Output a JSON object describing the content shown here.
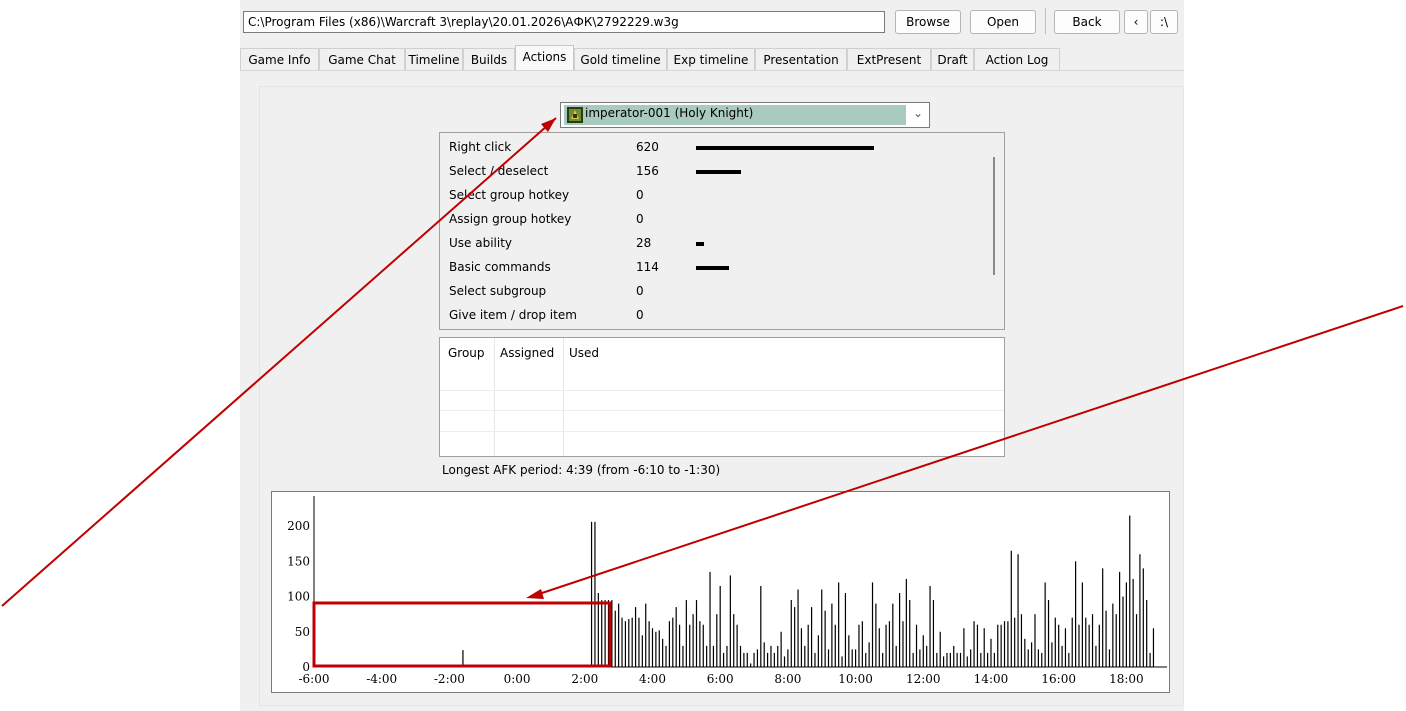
{
  "toolbar": {
    "path": "C:\\Program Files (x86)\\Warcraft 3\\replay\\20.01.2026\\АФК\\2792229.w3g",
    "browse": "Browse",
    "open": "Open",
    "back": "Back",
    "prev": "‹",
    "next": ":\\"
  },
  "tabs": [
    "Game Info",
    "Game Chat",
    "Timeline",
    "Builds",
    "Actions",
    "Gold timeline",
    "Exp timeline",
    "Presentation",
    "ExtPresent",
    "Draft",
    "Action Log"
  ],
  "active_tab": "Actions",
  "player": {
    "selected": "imperator-001 (Holy Knight)"
  },
  "actions": [
    {
      "name": "Right click",
      "value": "620",
      "bar": 620
    },
    {
      "name": "Select / deselect",
      "value": "156",
      "bar": 156
    },
    {
      "name": "Select group hotkey",
      "value": "0",
      "bar": 0
    },
    {
      "name": "Assign group hotkey",
      "value": "0",
      "bar": 0
    },
    {
      "name": "Use ability",
      "value": "28",
      "bar": 28
    },
    {
      "name": "Basic commands",
      "value": "114",
      "bar": 114
    },
    {
      "name": "Select subgroup",
      "value": "0",
      "bar": 0
    },
    {
      "name": "Give item / drop item",
      "value": "0",
      "bar": 0
    }
  ],
  "group_table": {
    "headers": [
      "Group",
      "Assigned",
      "Used"
    ]
  },
  "afk_text": "Longest AFK period: 4:39 (from -6:10 to -1:30)",
  "colors": {
    "accent_red": "#c00000",
    "selection": "#a9cabf"
  },
  "chart_data": {
    "type": "bar",
    "xlabel": "",
    "ylabel": "",
    "xlim": [
      -6,
      19.2
    ],
    "ylim": [
      0,
      220
    ],
    "y_ticks": [
      "0",
      "50",
      "100",
      "150",
      "200"
    ],
    "x_ticks": [
      "-6:00",
      "-4:00",
      "-2:00",
      "0:00",
      "2:00",
      "4:00",
      "6:00",
      "8:00",
      "10:00",
      "12:00",
      "14:00",
      "16:00",
      "18:00"
    ],
    "x": [
      -1.6,
      2.2,
      2.3,
      2.4,
      2.5,
      2.6,
      2.7,
      2.8,
      2.9,
      3.0,
      3.1,
      3.2,
      3.3,
      3.4,
      3.5,
      3.6,
      3.7,
      3.8,
      3.9,
      4.0,
      4.1,
      4.2,
      4.3,
      4.4,
      4.5,
      4.6,
      4.7,
      4.8,
      4.9,
      5.0,
      5.1,
      5.2,
      5.3,
      5.4,
      5.5,
      5.6,
      5.7,
      5.8,
      5.9,
      6.0,
      6.1,
      6.2,
      6.3,
      6.4,
      6.5,
      6.6,
      6.7,
      6.8,
      6.9,
      7.0,
      7.1,
      7.2,
      7.3,
      7.4,
      7.5,
      7.6,
      7.7,
      7.8,
      7.9,
      8.0,
      8.1,
      8.2,
      8.3,
      8.4,
      8.5,
      8.6,
      8.7,
      8.8,
      8.9,
      9.0,
      9.1,
      9.2,
      9.3,
      9.4,
      9.5,
      9.6,
      9.7,
      9.8,
      9.9,
      10.0,
      10.1,
      10.2,
      10.3,
      10.4,
      10.5,
      10.6,
      10.7,
      10.8,
      10.9,
      11.0,
      11.1,
      11.2,
      11.3,
      11.4,
      11.5,
      11.6,
      11.7,
      11.8,
      11.9,
      12.0,
      12.1,
      12.2,
      12.3,
      12.4,
      12.5,
      12.6,
      12.7,
      12.8,
      12.9,
      13.0,
      13.1,
      13.2,
      13.3,
      13.4,
      13.5,
      13.6,
      13.7,
      13.8,
      13.9,
      14.0,
      14.1,
      14.2,
      14.3,
      14.4,
      14.5,
      14.6,
      14.7,
      14.8,
      14.9,
      15.0,
      15.1,
      15.2,
      15.3,
      15.4,
      15.5,
      15.6,
      15.7,
      15.8,
      15.9,
      16.0,
      16.1,
      16.2,
      16.3,
      16.4,
      16.5,
      16.6,
      16.7,
      16.8,
      16.9,
      17.0,
      17.1,
      17.2,
      17.3,
      17.4,
      17.5,
      17.6,
      17.7,
      17.8,
      17.9,
      18.0,
      18.1,
      18.2,
      18.3,
      18.4,
      18.5,
      18.6,
      18.7,
      18.8,
      18.9,
      19.0,
      19.1
    ],
    "values": [
      24,
      206,
      206,
      105,
      95,
      95,
      95,
      95,
      80,
      90,
      70,
      65,
      68,
      70,
      85,
      70,
      45,
      90,
      65,
      55,
      50,
      52,
      40,
      30,
      65,
      70,
      85,
      60,
      30,
      95,
      60,
      75,
      95,
      65,
      60,
      30,
      135,
      30,
      75,
      115,
      20,
      30,
      130,
      75,
      60,
      30,
      20,
      20,
      5,
      20,
      25,
      115,
      35,
      20,
      30,
      20,
      30,
      50,
      15,
      25,
      95,
      85,
      110,
      55,
      30,
      60,
      85,
      20,
      45,
      110,
      80,
      25,
      90,
      60,
      120,
      15,
      105,
      45,
      25,
      25,
      60,
      65,
      20,
      35,
      120,
      90,
      55,
      20,
      60,
      65,
      90,
      30,
      105,
      65,
      125,
      95,
      20,
      60,
      25,
      45,
      30,
      115,
      95,
      20,
      50,
      15,
      20,
      20,
      30,
      20,
      20,
      55,
      15,
      25,
      65,
      60,
      20,
      55,
      20,
      40,
      20,
      60,
      60,
      65,
      65,
      165,
      70,
      160,
      75,
      40,
      25,
      35,
      75,
      25,
      20,
      120,
      95,
      35,
      70,
      60,
      30,
      55,
      20,
      70,
      150,
      60,
      120,
      70,
      60,
      75,
      30,
      60,
      140,
      80,
      25,
      90,
      75,
      135,
      100,
      120,
      215,
      125,
      75,
      160,
      140,
      95,
      20,
      55
    ]
  }
}
